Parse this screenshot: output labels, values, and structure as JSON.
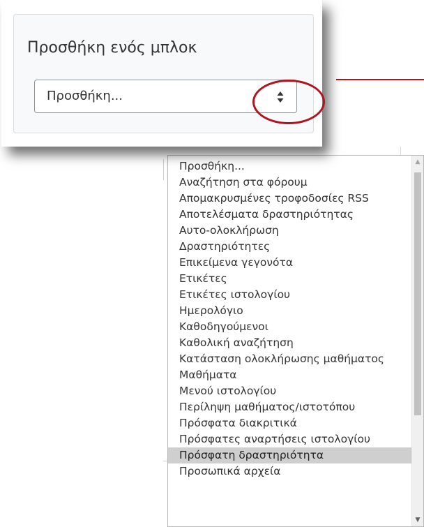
{
  "block": {
    "title": "Προσθήκη ενός μπλοκ",
    "select_value": "Προσθήκη..."
  },
  "dropdown": {
    "options": [
      "Προσθήκη...",
      "Αναζήτηση στα φόρουμ",
      "Απομακρυσμένες τροφοδοσίες RSS",
      "Αποτελέσματα δραστηριότητας",
      "Αυτο-ολοκλήρωση",
      "Δραστηριότητες",
      "Επικείμενα γεγονότα",
      "Ετικέτες",
      "Ετικέτες ιστολογίου",
      "Ημερολόγιο",
      "Καθοδηγούμενοι",
      "Καθολική αναζήτηση",
      "Κατάσταση ολοκλήρωσης μαθήματος",
      "Μαθήματα",
      "Μενού ιστολογίου",
      "Περίληψη μαθήματος/ιστοτόπου",
      "Πρόσφατα διακριτικά",
      "Πρόσφατες αναρτήσεις ιστολογίου",
      "Πρόσφατη δραστηριότητα",
      "Προσωπικά αρχεία"
    ],
    "highlighted": "Πρόσφατη δραστηριότητα"
  },
  "colors": {
    "annotation": "#b0141e",
    "highlight": "#cfcfcf"
  }
}
